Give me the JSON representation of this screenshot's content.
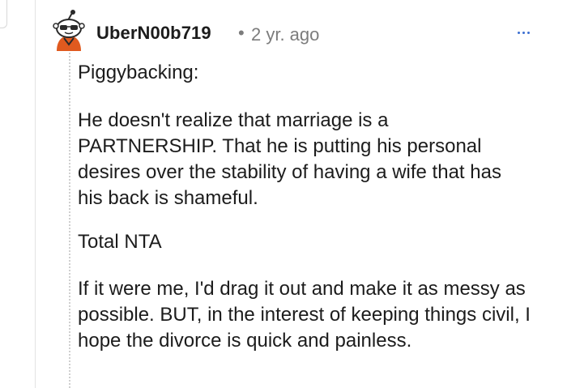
{
  "comment": {
    "username": "UberN00b719",
    "separator": "•",
    "timestamp": "2 yr. ago",
    "more_label": "...",
    "paragraphs": [
      "Piggybacking:",
      "He doesn't realize that marriage is a PARTNERSHIP. That he is putting his personal desires over the stability of having a wife that has his back is shameful.",
      "Total NTA",
      "If it were me, I'd drag it out and make it as messy as possible. BUT, in the interest of keeping things civil, I hope the divorce is quick and painless."
    ]
  },
  "icons": {
    "avatar": "snoo-avatar-icon",
    "more": "more-options-icon"
  },
  "colors": {
    "text": "#1c1c1c",
    "meta": "#7c7c7c",
    "accent": "#3c6fd1",
    "thread_line": "#cfcfcf",
    "avatar_shirt": "#e05a1f"
  }
}
